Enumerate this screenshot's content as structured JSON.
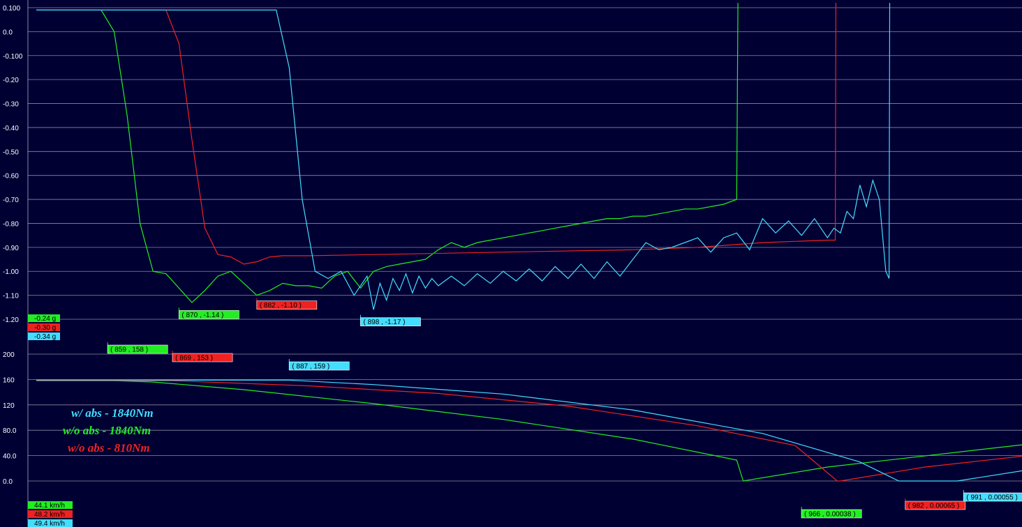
{
  "colors": {
    "background": "#000033",
    "grid": "#b8b8c8",
    "cyan": "#44ddff",
    "green": "#22ee22",
    "red": "#ee2222"
  },
  "chart_data": [
    {
      "type": "line",
      "title": "",
      "xlabel": "",
      "ylabel": "",
      "y_unit": "g",
      "xlim": [
        847,
        1000
      ],
      "ylim": [
        -1.25,
        0.12
      ],
      "grid": true,
      "y_ticks": [
        "0.100",
        "0.0",
        "-0.100",
        "-0.20",
        "-0.30",
        "-0.40",
        "-0.50",
        "-0.60",
        "-0.70",
        "-0.80",
        "-0.90",
        "-1.00",
        "-1.10",
        "-1.20"
      ],
      "y_tick_values": [
        0.1,
        0.0,
        -0.1,
        -0.2,
        -0.3,
        -0.4,
        -0.5,
        -0.6,
        -0.7,
        -0.8,
        -0.9,
        -1.0,
        -1.1,
        -1.2
      ],
      "cursor_values": [
        {
          "text": "-0.24  g",
          "color": "green"
        },
        {
          "text": "-0.30  g",
          "color": "red"
        },
        {
          "text": "-0.34  g",
          "color": "cyan"
        }
      ],
      "markers": [
        {
          "text": "(  870 ,  -1.14 )",
          "color": "green",
          "x": 870,
          "y": -1.14
        },
        {
          "text": "(  882 ,  -1.10 )",
          "color": "red",
          "x": 882,
          "y": -1.1
        },
        {
          "text": "(  898 ,  -1.17 )",
          "color": "cyan",
          "x": 898,
          "y": -1.17
        }
      ],
      "series": [
        {
          "color": "green",
          "x": [
            848,
            858,
            860,
            862,
            864,
            866,
            868,
            870,
            872,
            874,
            876,
            878,
            880,
            882,
            884,
            886,
            888,
            890,
            892,
            894,
            896,
            898,
            900,
            902,
            904,
            906,
            908,
            910,
            912,
            914,
            916,
            918,
            920,
            922,
            924,
            926,
            928,
            930,
            932,
            934,
            936,
            938,
            940,
            942,
            944,
            946,
            948,
            950,
            952,
            954,
            956,
            956.2
          ],
          "y": [
            0.09,
            0.09,
            0.0,
            -0.35,
            -0.8,
            -1.0,
            -1.01,
            -1.07,
            -1.13,
            -1.08,
            -1.02,
            -1.0,
            -1.05,
            -1.1,
            -1.08,
            -1.05,
            -1.06,
            -1.06,
            -1.07,
            -1.02,
            -1.0,
            -1.07,
            -1.0,
            -0.98,
            -0.97,
            -0.96,
            -0.95,
            -0.91,
            -0.88,
            -0.9,
            -0.88,
            -0.87,
            -0.86,
            -0.85,
            -0.84,
            -0.83,
            -0.82,
            -0.81,
            -0.8,
            -0.79,
            -0.78,
            -0.78,
            -0.77,
            -0.77,
            -0.76,
            -0.75,
            -0.74,
            -0.74,
            -0.73,
            -0.72,
            -0.7,
            0.12
          ]
        },
        {
          "color": "red",
          "x": [
            848,
            868,
            870,
            872,
            874,
            876,
            878,
            880,
            882,
            884,
            886,
            888,
            890,
            900,
            920,
            940,
            950,
            960,
            970,
            971.2,
            971.3
          ],
          "y": [
            0.09,
            0.09,
            -0.05,
            -0.45,
            -0.82,
            -0.93,
            -0.94,
            -0.97,
            -0.96,
            -0.94,
            -0.935,
            -0.935,
            -0.935,
            -0.93,
            -0.92,
            -0.91,
            -0.9,
            -0.88,
            -0.87,
            -0.87,
            0.12
          ]
        },
        {
          "color": "cyan",
          "x": [
            848,
            885,
            887,
            889,
            891,
            893,
            895,
            897,
            899,
            900,
            901,
            902,
            903,
            904,
            905,
            906,
            907,
            908,
            909,
            910,
            912,
            914,
            916,
            918,
            920,
            922,
            924,
            926,
            928,
            930,
            932,
            934,
            936,
            938,
            940,
            942,
            944,
            946,
            948,
            950,
            952,
            954,
            956,
            958,
            960,
            962,
            964,
            966,
            968,
            970,
            971,
            972,
            973,
            974,
            975,
            976,
            977,
            978,
            979,
            979.5,
            979.6
          ],
          "y": [
            0.09,
            0.09,
            -0.15,
            -0.7,
            -1.0,
            -1.03,
            -1.0,
            -1.1,
            -1.02,
            -1.16,
            -1.05,
            -1.12,
            -1.03,
            -1.08,
            -1.01,
            -1.09,
            -1.02,
            -1.07,
            -1.03,
            -1.06,
            -1.02,
            -1.06,
            -1.01,
            -1.05,
            -1.0,
            -1.04,
            -0.99,
            -1.04,
            -0.98,
            -1.03,
            -0.97,
            -1.03,
            -0.96,
            -1.02,
            -0.95,
            -0.88,
            -0.91,
            -0.9,
            -0.88,
            -0.86,
            -0.92,
            -0.86,
            -0.84,
            -0.91,
            -0.78,
            -0.84,
            -0.79,
            -0.85,
            -0.78,
            -0.86,
            -0.82,
            -0.84,
            -0.75,
            -0.78,
            -0.64,
            -0.73,
            -0.62,
            -0.7,
            -1.0,
            -1.03,
            0.12
          ]
        }
      ]
    },
    {
      "type": "line",
      "title": "",
      "xlabel": "",
      "ylabel": "",
      "y_unit": "km/h",
      "xlim": [
        847,
        1000
      ],
      "ylim": [
        -10,
        215
      ],
      "grid": true,
      "y_ticks": [
        "200",
        "160",
        "120",
        "80.0",
        "40.0",
        "0.0"
      ],
      "y_tick_values": [
        200,
        160,
        120,
        80,
        40,
        0
      ],
      "cursor_values": [
        {
          "text": "44.1  km/h",
          "color": "green"
        },
        {
          "text": "48.2  km/h",
          "color": "red"
        },
        {
          "text": "49.4  km/h",
          "color": "cyan"
        }
      ],
      "markers": [
        {
          "text": "(  859 ,   158 )",
          "color": "green",
          "x": 859,
          "y": 158
        },
        {
          "text": "(  869 ,   153 )",
          "color": "red",
          "x": 869,
          "y": 153
        },
        {
          "text": "(  887 ,   159 )",
          "color": "cyan",
          "x": 887,
          "y": 159
        },
        {
          "text": "(  966 , 0.00038 )",
          "color": "green",
          "x": 966,
          "y": 0.00038
        },
        {
          "text": "(  982 , 0.00065 )",
          "color": "red",
          "x": 982,
          "y": 0.00065
        },
        {
          "text": "(  991 , 0.00055 )",
          "color": "cyan",
          "x": 991,
          "y": 0.00055
        }
      ],
      "legend": [
        {
          "text": "w/ abs - 1840Nm",
          "color": "cyan"
        },
        {
          "text": "w/o abs - 1840Nm",
          "color": "green"
        },
        {
          "text": "w/o abs - 810Nm",
          "color": "red"
        }
      ],
      "legend_position": "left",
      "series": [
        {
          "color": "green",
          "x": [
            848,
            860,
            866,
            880,
            900,
            920,
            940,
            956,
            957,
            970,
            1000
          ],
          "y": [
            158,
            158,
            156,
            144,
            122,
            97,
            66,
            33,
            0,
            22,
            57
          ]
        },
        {
          "color": "red",
          "x": [
            848,
            869,
            890,
            910,
            930,
            950,
            965,
            971.5,
            972,
            985,
            1000
          ],
          "y": [
            158,
            158,
            150,
            138,
            118,
            87,
            56,
            0,
            0,
            22,
            39
          ]
        },
        {
          "color": "cyan",
          "x": [
            848,
            887,
            900,
            920,
            940,
            960,
            975,
            981,
            990,
            1000
          ],
          "y": [
            159,
            159,
            152,
            137,
            112,
            75,
            30,
            0,
            0,
            16
          ]
        }
      ]
    }
  ]
}
